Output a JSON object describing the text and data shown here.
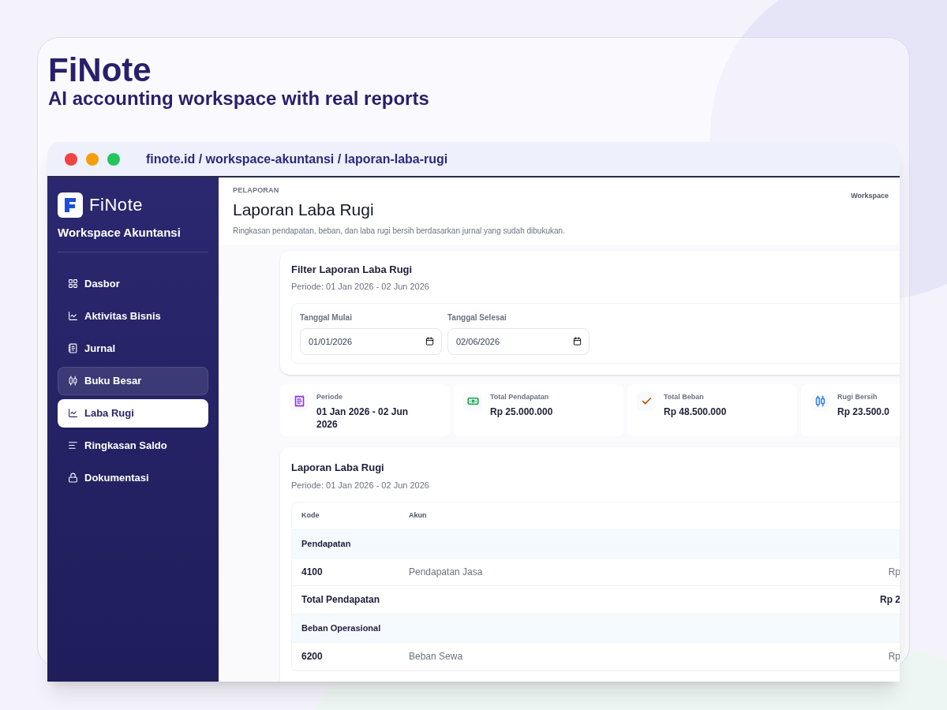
{
  "hero": {
    "title": "FiNote",
    "subtitle": "AI accounting workspace with real reports"
  },
  "browser": {
    "address": "finote.id / workspace-akuntansi / laporan-laba-rugi"
  },
  "sidebar": {
    "brand": "FiNote",
    "workspace": "Workspace Akuntansi",
    "items": [
      {
        "label": "Dasbor",
        "selected": false,
        "hovered": false
      },
      {
        "label": "Aktivitas Bisnis",
        "selected": false,
        "hovered": false
      },
      {
        "label": "Jurnal",
        "selected": false,
        "hovered": false
      },
      {
        "label": "Buku Besar",
        "selected": false,
        "hovered": true
      },
      {
        "label": "Laba Rugi",
        "selected": true,
        "hovered": false
      },
      {
        "label": "Ringkasan Saldo",
        "selected": false,
        "hovered": false
      },
      {
        "label": "Dokumentasi",
        "selected": false,
        "hovered": false
      }
    ]
  },
  "header": {
    "eyebrow": "PELAPORAN",
    "title": "Laporan Laba Rugi",
    "description": "Ringkasan pendapatan, beban, dan laba rugi bersih berdasarkan jurnal yang sudah dibukukan.",
    "workspace_label": "Workspace"
  },
  "filter": {
    "title": "Filter Laporan Laba Rugi",
    "period": "Periode: 01 Jan 2026 - 02 Jun 2026",
    "fields": [
      {
        "label": "Tanggal Mulai",
        "value": "01/01/2026"
      },
      {
        "label": "Tanggal Selesai",
        "value": "02/06/2026"
      }
    ]
  },
  "stats": [
    {
      "label": "Periode",
      "value": "01 Jan 2026 - 02 Jun 2026",
      "color": "#9333ea"
    },
    {
      "label": "Total Pendapatan",
      "value": "Rp 25.000.000",
      "color": "#16a34a"
    },
    {
      "label": "Total Beban",
      "value": "Rp 48.500.000",
      "color": "#b45309"
    },
    {
      "label": "Rugi Bersih",
      "value": "Rp 23.500.0",
      "color": "#3b82f6"
    }
  ],
  "report": {
    "title": "Laporan Laba Rugi",
    "period": "Periode: 01 Jan 2026 - 02 Jun 2026",
    "columns": [
      "Kode",
      "Akun"
    ],
    "rows": [
      {
        "kind": "group",
        "label": "Pendapatan"
      },
      {
        "kind": "account",
        "code": "4100",
        "name": "Pendapatan Jasa",
        "amount": "Rp"
      },
      {
        "kind": "total",
        "label": "Total Pendapatan",
        "amount": "Rp 2"
      },
      {
        "kind": "group",
        "label": "Beban Operasional"
      },
      {
        "kind": "account",
        "code": "6200",
        "name": "Beban Sewa",
        "amount": "Rp"
      }
    ]
  }
}
